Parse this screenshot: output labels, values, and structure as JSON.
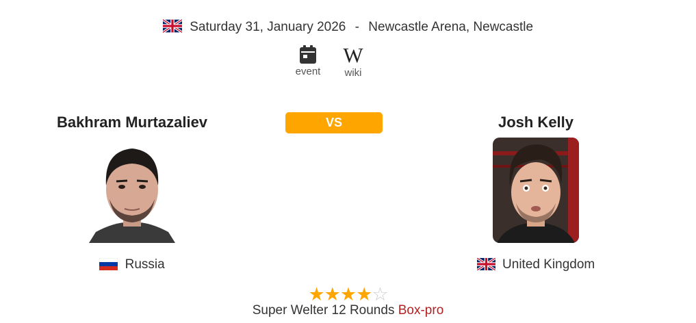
{
  "event": {
    "date": "Saturday 31, January 2026",
    "separator": "-",
    "venue": "Newcastle Arena, Newcastle",
    "flag_icon": "uk-flag-icon"
  },
  "links": {
    "event_label": "event",
    "event_icon": "calendar-icon",
    "wiki_glyph": "W",
    "wiki_label": "wiki",
    "wiki_icon": "wikipedia-icon"
  },
  "vs_label": "VS",
  "fighter_left": {
    "name": "Bakhram Murtazaliev",
    "country": "Russia",
    "flag_icon": "russia-flag-icon"
  },
  "fighter_right": {
    "name": "Josh Kelly",
    "country": "United Kingdom",
    "flag_icon": "uk-flag-icon"
  },
  "rating": {
    "value": 4,
    "max": 5,
    "star_on": "★",
    "star_off": "☆"
  },
  "bout": {
    "description": "Super Welter 12 Rounds",
    "category": "Box-pro"
  },
  "colors": {
    "accent": "#ffa500",
    "category_link": "#b22222"
  }
}
